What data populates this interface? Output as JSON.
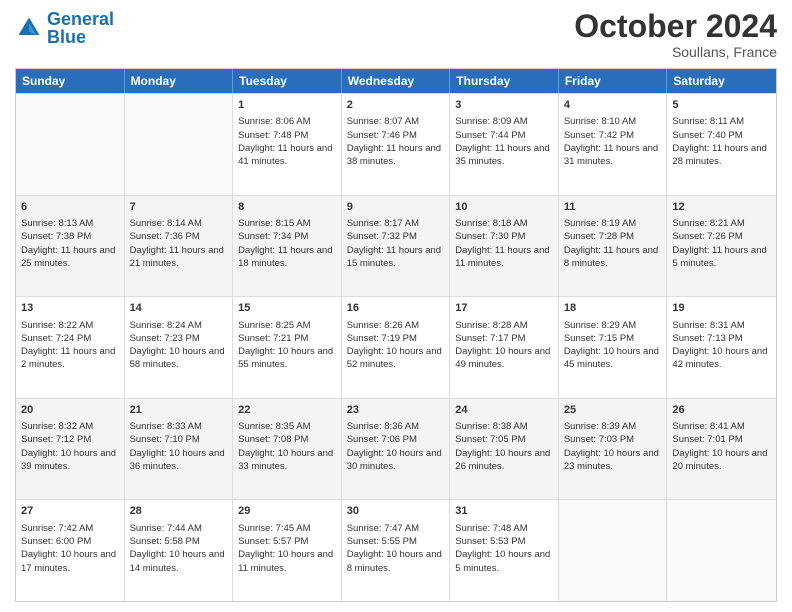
{
  "header": {
    "logo_general": "General",
    "logo_blue": "Blue",
    "month": "October 2024",
    "location": "Soullans, France"
  },
  "days_of_week": [
    "Sunday",
    "Monday",
    "Tuesday",
    "Wednesday",
    "Thursday",
    "Friday",
    "Saturday"
  ],
  "weeks": [
    [
      {
        "day": "",
        "sunrise": "",
        "sunset": "",
        "daylight": "",
        "empty": true
      },
      {
        "day": "",
        "sunrise": "",
        "sunset": "",
        "daylight": "",
        "empty": true
      },
      {
        "day": "1",
        "sunrise": "Sunrise: 8:06 AM",
        "sunset": "Sunset: 7:48 PM",
        "daylight": "Daylight: 11 hours and 41 minutes.",
        "empty": false
      },
      {
        "day": "2",
        "sunrise": "Sunrise: 8:07 AM",
        "sunset": "Sunset: 7:46 PM",
        "daylight": "Daylight: 11 hours and 38 minutes.",
        "empty": false
      },
      {
        "day": "3",
        "sunrise": "Sunrise: 8:09 AM",
        "sunset": "Sunset: 7:44 PM",
        "daylight": "Daylight: 11 hours and 35 minutes.",
        "empty": false
      },
      {
        "day": "4",
        "sunrise": "Sunrise: 8:10 AM",
        "sunset": "Sunset: 7:42 PM",
        "daylight": "Daylight: 11 hours and 31 minutes.",
        "empty": false
      },
      {
        "day": "5",
        "sunrise": "Sunrise: 8:11 AM",
        "sunset": "Sunset: 7:40 PM",
        "daylight": "Daylight: 11 hours and 28 minutes.",
        "empty": false
      }
    ],
    [
      {
        "day": "6",
        "sunrise": "Sunrise: 8:13 AM",
        "sunset": "Sunset: 7:38 PM",
        "daylight": "Daylight: 11 hours and 25 minutes.",
        "empty": false
      },
      {
        "day": "7",
        "sunrise": "Sunrise: 8:14 AM",
        "sunset": "Sunset: 7:36 PM",
        "daylight": "Daylight: 11 hours and 21 minutes.",
        "empty": false
      },
      {
        "day": "8",
        "sunrise": "Sunrise: 8:15 AM",
        "sunset": "Sunset: 7:34 PM",
        "daylight": "Daylight: 11 hours and 18 minutes.",
        "empty": false
      },
      {
        "day": "9",
        "sunrise": "Sunrise: 8:17 AM",
        "sunset": "Sunset: 7:32 PM",
        "daylight": "Daylight: 11 hours and 15 minutes.",
        "empty": false
      },
      {
        "day": "10",
        "sunrise": "Sunrise: 8:18 AM",
        "sunset": "Sunset: 7:30 PM",
        "daylight": "Daylight: 11 hours and 11 minutes.",
        "empty": false
      },
      {
        "day": "11",
        "sunrise": "Sunrise: 8:19 AM",
        "sunset": "Sunset: 7:28 PM",
        "daylight": "Daylight: 11 hours and 8 minutes.",
        "empty": false
      },
      {
        "day": "12",
        "sunrise": "Sunrise: 8:21 AM",
        "sunset": "Sunset: 7:26 PM",
        "daylight": "Daylight: 11 hours and 5 minutes.",
        "empty": false
      }
    ],
    [
      {
        "day": "13",
        "sunrise": "Sunrise: 8:22 AM",
        "sunset": "Sunset: 7:24 PM",
        "daylight": "Daylight: 11 hours and 2 minutes.",
        "empty": false
      },
      {
        "day": "14",
        "sunrise": "Sunrise: 8:24 AM",
        "sunset": "Sunset: 7:23 PM",
        "daylight": "Daylight: 10 hours and 58 minutes.",
        "empty": false
      },
      {
        "day": "15",
        "sunrise": "Sunrise: 8:25 AM",
        "sunset": "Sunset: 7:21 PM",
        "daylight": "Daylight: 10 hours and 55 minutes.",
        "empty": false
      },
      {
        "day": "16",
        "sunrise": "Sunrise: 8:26 AM",
        "sunset": "Sunset: 7:19 PM",
        "daylight": "Daylight: 10 hours and 52 minutes.",
        "empty": false
      },
      {
        "day": "17",
        "sunrise": "Sunrise: 8:28 AM",
        "sunset": "Sunset: 7:17 PM",
        "daylight": "Daylight: 10 hours and 49 minutes.",
        "empty": false
      },
      {
        "day": "18",
        "sunrise": "Sunrise: 8:29 AM",
        "sunset": "Sunset: 7:15 PM",
        "daylight": "Daylight: 10 hours and 45 minutes.",
        "empty": false
      },
      {
        "day": "19",
        "sunrise": "Sunrise: 8:31 AM",
        "sunset": "Sunset: 7:13 PM",
        "daylight": "Daylight: 10 hours and 42 minutes.",
        "empty": false
      }
    ],
    [
      {
        "day": "20",
        "sunrise": "Sunrise: 8:32 AM",
        "sunset": "Sunset: 7:12 PM",
        "daylight": "Daylight: 10 hours and 39 minutes.",
        "empty": false
      },
      {
        "day": "21",
        "sunrise": "Sunrise: 8:33 AM",
        "sunset": "Sunset: 7:10 PM",
        "daylight": "Daylight: 10 hours and 36 minutes.",
        "empty": false
      },
      {
        "day": "22",
        "sunrise": "Sunrise: 8:35 AM",
        "sunset": "Sunset: 7:08 PM",
        "daylight": "Daylight: 10 hours and 33 minutes.",
        "empty": false
      },
      {
        "day": "23",
        "sunrise": "Sunrise: 8:36 AM",
        "sunset": "Sunset: 7:06 PM",
        "daylight": "Daylight: 10 hours and 30 minutes.",
        "empty": false
      },
      {
        "day": "24",
        "sunrise": "Sunrise: 8:38 AM",
        "sunset": "Sunset: 7:05 PM",
        "daylight": "Daylight: 10 hours and 26 minutes.",
        "empty": false
      },
      {
        "day": "25",
        "sunrise": "Sunrise: 8:39 AM",
        "sunset": "Sunset: 7:03 PM",
        "daylight": "Daylight: 10 hours and 23 minutes.",
        "empty": false
      },
      {
        "day": "26",
        "sunrise": "Sunrise: 8:41 AM",
        "sunset": "Sunset: 7:01 PM",
        "daylight": "Daylight: 10 hours and 20 minutes.",
        "empty": false
      }
    ],
    [
      {
        "day": "27",
        "sunrise": "Sunrise: 7:42 AM",
        "sunset": "Sunset: 6:00 PM",
        "daylight": "Daylight: 10 hours and 17 minutes.",
        "empty": false
      },
      {
        "day": "28",
        "sunrise": "Sunrise: 7:44 AM",
        "sunset": "Sunset: 5:58 PM",
        "daylight": "Daylight: 10 hours and 14 minutes.",
        "empty": false
      },
      {
        "day": "29",
        "sunrise": "Sunrise: 7:45 AM",
        "sunset": "Sunset: 5:57 PM",
        "daylight": "Daylight: 10 hours and 11 minutes.",
        "empty": false
      },
      {
        "day": "30",
        "sunrise": "Sunrise: 7:47 AM",
        "sunset": "Sunset: 5:55 PM",
        "daylight": "Daylight: 10 hours and 8 minutes.",
        "empty": false
      },
      {
        "day": "31",
        "sunrise": "Sunrise: 7:48 AM",
        "sunset": "Sunset: 5:53 PM",
        "daylight": "Daylight: 10 hours and 5 minutes.",
        "empty": false
      },
      {
        "day": "",
        "sunrise": "",
        "sunset": "",
        "daylight": "",
        "empty": true
      },
      {
        "day": "",
        "sunrise": "",
        "sunset": "",
        "daylight": "",
        "empty": true
      }
    ]
  ]
}
